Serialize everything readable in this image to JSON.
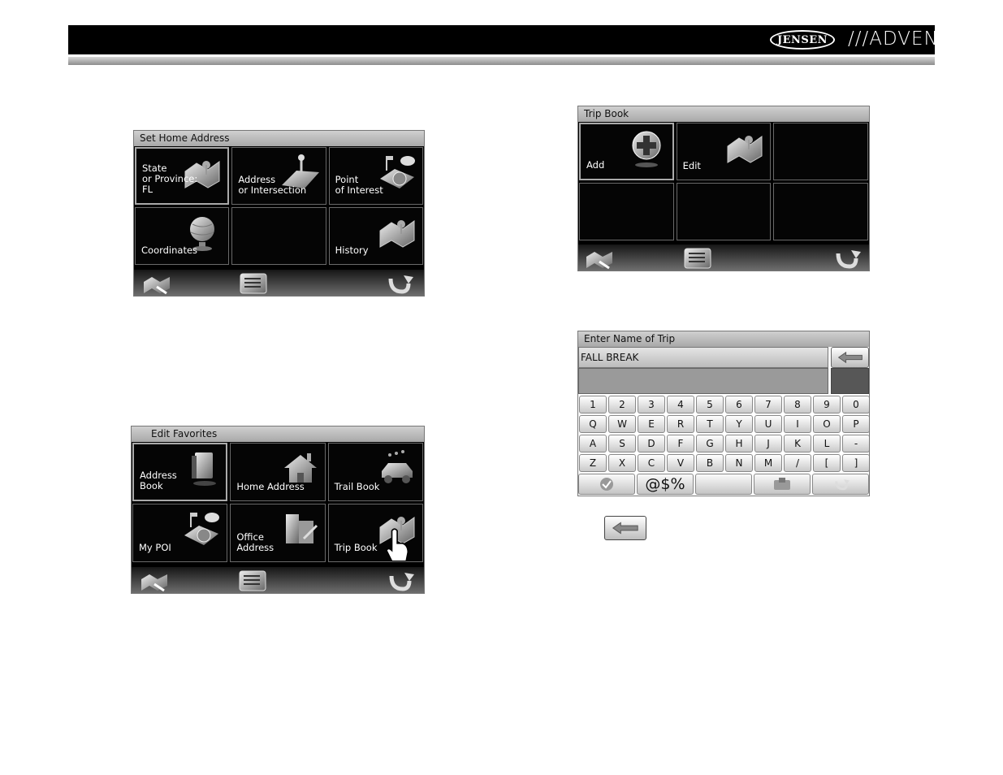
{
  "header": {
    "brand_jensen": "JENSEN",
    "brand_advent": "///ADVENT"
  },
  "screens": {
    "set_home": {
      "title": "Set Home Address",
      "tiles": [
        {
          "label": "State\nor Province:\nFL",
          "icon": "state-map-icon"
        },
        {
          "label": "Address\nor Intersection",
          "icon": "road-pin-icon"
        },
        {
          "label": "Point\nof Interest",
          "icon": "poi-cup-icon"
        },
        {
          "label": "Coordinates",
          "icon": "globe-icon"
        },
        {
          "label": "",
          "icon": ""
        },
        {
          "label": "History",
          "icon": "history-map-icon"
        }
      ]
    },
    "edit_favorites": {
      "title": "Edit Favorites",
      "tiles": [
        {
          "label": "Address\nBook",
          "icon": "address-book-icon"
        },
        {
          "label": "Home Address",
          "icon": "house-icon"
        },
        {
          "label": "Trail Book",
          "icon": "jeep-trail-icon"
        },
        {
          "label": "My POI",
          "icon": "poi-cup-icon"
        },
        {
          "label": "Office\nAddress",
          "icon": "office-building-icon"
        },
        {
          "label": "Trip Book",
          "icon": "trip-map-icon"
        }
      ]
    },
    "trip_book": {
      "title": "Trip Book",
      "tiles": [
        {
          "label": "Add",
          "icon": "add-plus-icon"
        },
        {
          "label": "Edit",
          "icon": "edit-map-icon"
        },
        {
          "label": "",
          "icon": ""
        },
        {
          "label": "",
          "icon": ""
        },
        {
          "label": "",
          "icon": ""
        },
        {
          "label": "",
          "icon": ""
        }
      ]
    },
    "enter_name": {
      "title": "Enter Name of Trip",
      "input_value": "FALL BREAK",
      "key_rows": [
        [
          "1",
          "2",
          "3",
          "4",
          "5",
          "6",
          "7",
          "8",
          "9",
          "0"
        ],
        [
          "Q",
          "W",
          "E",
          "R",
          "T",
          "Y",
          "U",
          "I",
          "O",
          "P"
        ],
        [
          "A",
          "S",
          "D",
          "F",
          "G",
          "H",
          "J",
          "K",
          "L",
          "-"
        ],
        [
          "Z",
          "X",
          "C",
          "V",
          "B",
          "N",
          "M",
          "/",
          "[",
          "]"
        ]
      ],
      "symbols_label": "@$%"
    }
  },
  "icons": {
    "bottom_left": "map-hand-icon",
    "bottom_mid": "list-menu-icon",
    "bottom_right": "back-arrow-icon",
    "backspace": "backspace-arrow-icon"
  }
}
